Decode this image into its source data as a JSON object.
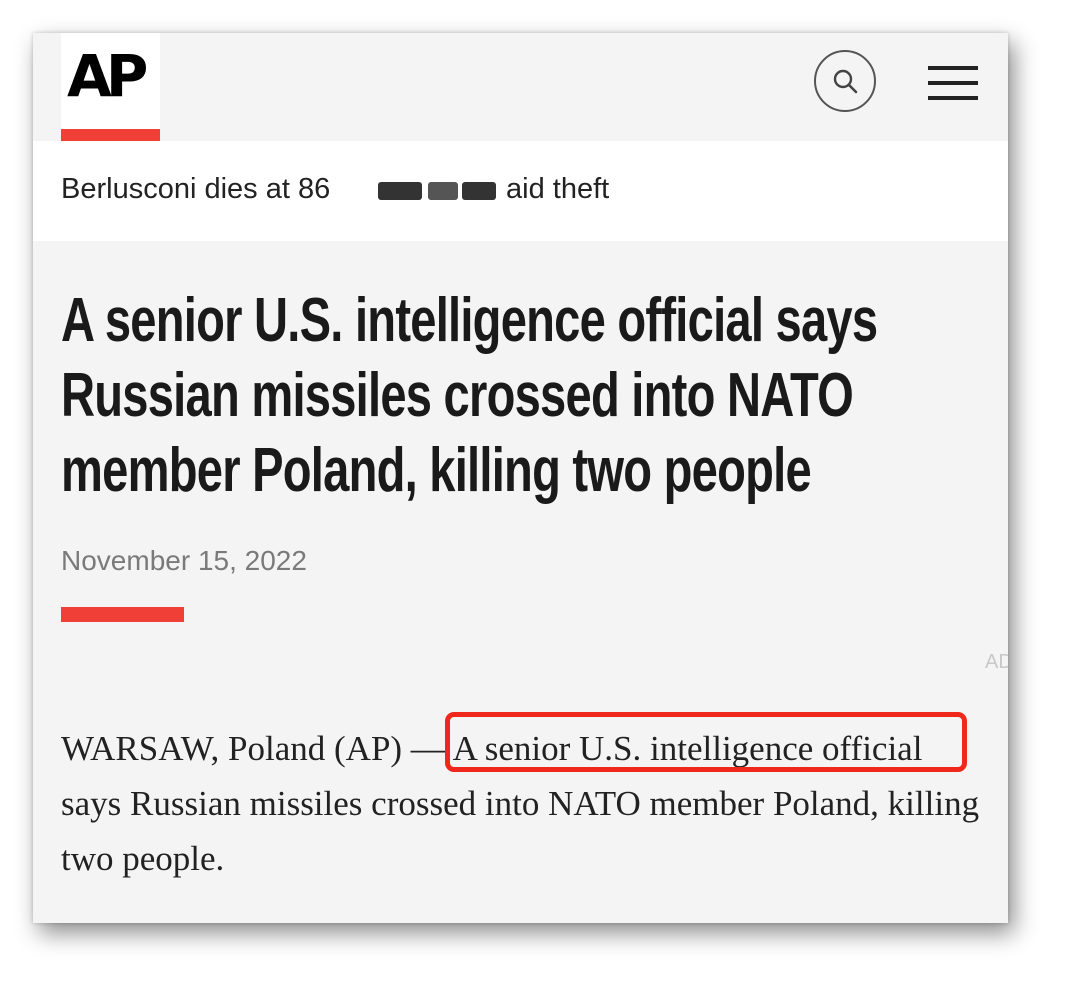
{
  "header": {
    "logo_text": "AP",
    "search_icon": "search-icon",
    "menu_icon": "hamburger-menu-icon",
    "brand_color": "#ef3f37"
  },
  "trending": {
    "items": [
      "Berlusconi dies at 86",
      "aid theft"
    ]
  },
  "article": {
    "headline": "A senior U.S. intelligence official says Russian missiles crossed into NATO member Poland, killing two people",
    "date": "November 15, 2022",
    "ad_label": "AD",
    "dateline": "WARSAW, Poland (AP) — ",
    "highlighted": "A senior U.S. intelligence official",
    "rest": " says Russian missiles crossed into NATO member Poland, killing two people."
  },
  "annotation": {
    "highlight_color": "#f0271b"
  }
}
